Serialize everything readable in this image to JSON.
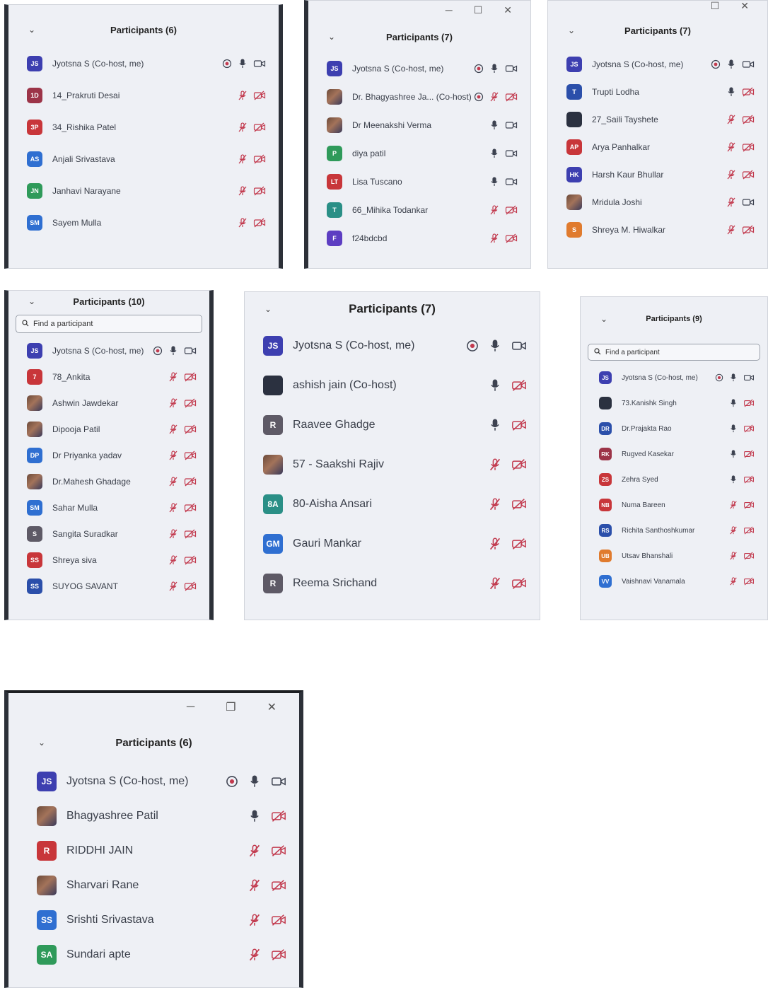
{
  "colors": {
    "purple": "#3d3fb0",
    "red": "#c8363a",
    "green": "#2f9a5a",
    "teal": "#2a8f86",
    "blue": "#2f6fd1",
    "navy": "#2b4faa",
    "maroon": "#9c3448",
    "gray": "#5e5a66",
    "orange": "#e07b2e",
    "dark": "#2b3140",
    "violet": "#5d3ec2",
    "muted_icon": "#c23a4e"
  },
  "panels": [
    {
      "title": "Participants (6)",
      "participants": [
        {
          "initials": "JS",
          "name": "Jyotsna S (Co-host, me)",
          "color": "purple",
          "record": true,
          "mic": "on",
          "video": "on"
        },
        {
          "initials": "1D",
          "name": "14_Prakruti Desai",
          "color": "maroon",
          "mic": "muted",
          "video": "off"
        },
        {
          "initials": "3P",
          "name": "34_Rishika Patel",
          "color": "red",
          "mic": "muted",
          "video": "off"
        },
        {
          "initials": "AS",
          "name": "Anjali Srivastava",
          "color": "blue",
          "mic": "muted",
          "video": "off"
        },
        {
          "initials": "JN",
          "name": "Janhavi Narayane",
          "color": "green",
          "mic": "muted",
          "video": "off"
        },
        {
          "initials": "SM",
          "name": "Sayem Mulla",
          "color": "blue",
          "mic": "muted",
          "video": "off"
        }
      ]
    },
    {
      "title": "Participants (7)",
      "participants": [
        {
          "initials": "JS",
          "name": "Jyotsna S (Co-host, me)",
          "color": "purple",
          "record": true,
          "mic": "on",
          "video": "on"
        },
        {
          "initials": "",
          "name": "Dr. Bhagyashree Ja... (Co-host)",
          "color": "photo",
          "record": true,
          "mic": "muted",
          "video": "off"
        },
        {
          "initials": "",
          "name": "Dr Meenakshi Verma",
          "color": "photo",
          "mic": "on",
          "video": "on"
        },
        {
          "initials": "P",
          "name": "diya patil",
          "color": "green",
          "mic": "on",
          "video": "on"
        },
        {
          "initials": "LT",
          "name": "Lisa Tuscano",
          "color": "red",
          "mic": "on",
          "video": "on"
        },
        {
          "initials": "T",
          "name": "66_Mihika Todankar",
          "color": "teal",
          "mic": "muted",
          "video": "off"
        },
        {
          "initials": "F",
          "name": "f24bdcbd",
          "color": "violet",
          "mic": "muted",
          "video": "off"
        }
      ]
    },
    {
      "title": "Participants (7)",
      "participants": [
        {
          "initials": "JS",
          "name": "Jyotsna S (Co-host, me)",
          "color": "purple",
          "record": true,
          "mic": "on",
          "video": "on"
        },
        {
          "initials": "T",
          "name": "Trupti Lodha",
          "color": "navy",
          "mic": "on",
          "video": "off"
        },
        {
          "initials": "",
          "name": "27_Saili Tayshete",
          "color": "dark",
          "mic": "muted",
          "video": "off"
        },
        {
          "initials": "AP",
          "name": "Arya Panhalkar",
          "color": "red",
          "mic": "muted",
          "video": "off"
        },
        {
          "initials": "HK",
          "name": "Harsh Kaur Bhullar",
          "color": "purple",
          "mic": "muted",
          "video": "off"
        },
        {
          "initials": "",
          "name": "Mridula Joshi",
          "color": "photo",
          "mic": "muted",
          "video": "on"
        },
        {
          "initials": "S",
          "name": "Shreya M. Hiwalkar",
          "color": "orange",
          "mic": "muted",
          "video": "off"
        }
      ]
    },
    {
      "title": "Participants (10)",
      "search_placeholder": "Find a participant",
      "participants": [
        {
          "initials": "JS",
          "name": "Jyotsna S (Co-host, me)",
          "color": "purple",
          "record": true,
          "mic": "on",
          "video": "on"
        },
        {
          "initials": "7",
          "name": "78_Ankita",
          "color": "red",
          "mic": "muted",
          "video": "off"
        },
        {
          "initials": "",
          "name": "Ashwin Jawdekar",
          "color": "photo",
          "mic": "muted",
          "video": "off"
        },
        {
          "initials": "",
          "name": "Dipooja Patil",
          "color": "photo",
          "mic": "muted",
          "video": "off"
        },
        {
          "initials": "DP",
          "name": "Dr Priyanka yadav",
          "color": "blue",
          "mic": "muted",
          "video": "off"
        },
        {
          "initials": "",
          "name": "Dr.Mahesh Ghadage",
          "color": "photo",
          "mic": "muted",
          "video": "off"
        },
        {
          "initials": "SM",
          "name": "Sahar Mulla",
          "color": "blue",
          "mic": "muted",
          "video": "off"
        },
        {
          "initials": "S",
          "name": "Sangita Suradkar",
          "color": "gray",
          "mic": "muted",
          "video": "off"
        },
        {
          "initials": "SS",
          "name": "Shreya siva",
          "color": "red",
          "mic": "muted",
          "video": "off"
        },
        {
          "initials": "SS",
          "name": "SUYOG SAVANT",
          "color": "navy",
          "mic": "muted",
          "video": "off"
        }
      ]
    },
    {
      "title": "Participants (7)",
      "participants": [
        {
          "initials": "JS",
          "name": "Jyotsna S (Co-host, me)",
          "color": "purple",
          "record": true,
          "mic": "on",
          "video": "on"
        },
        {
          "initials": "",
          "name": "ashish jain (Co-host)",
          "color": "dark",
          "mic": "on",
          "video": "off"
        },
        {
          "initials": "R",
          "name": "Raavee Ghadge",
          "color": "gray",
          "mic": "on",
          "video": "off"
        },
        {
          "initials": "",
          "name": "57 - Saakshi Rajiv",
          "color": "photo",
          "mic": "muted",
          "video": "off"
        },
        {
          "initials": "8A",
          "name": "80-Aisha Ansari",
          "color": "teal",
          "mic": "muted",
          "video": "off"
        },
        {
          "initials": "GM",
          "name": "Gauri Mankar",
          "color": "blue",
          "mic": "muted",
          "video": "off"
        },
        {
          "initials": "R",
          "name": "Reema Srichand",
          "color": "gray",
          "mic": "muted",
          "video": "off"
        }
      ]
    },
    {
      "title": "Participants (9)",
      "search_placeholder": "Find a participant",
      "participants": [
        {
          "initials": "JS",
          "name": "Jyotsna S (Co-host, me)",
          "color": "purple",
          "record": true,
          "mic": "on",
          "video": "on"
        },
        {
          "initials": "",
          "name": "73.Kanishk Singh",
          "color": "dark",
          "mic": "on",
          "video": "off"
        },
        {
          "initials": "DR",
          "name": "Dr.Prajakta Rao",
          "color": "navy",
          "mic": "on",
          "video": "off"
        },
        {
          "initials": "RK",
          "name": "Rugved Kasekar",
          "color": "maroon",
          "mic": "on",
          "video": "off"
        },
        {
          "initials": "ZS",
          "name": "Zehra Syed",
          "color": "red",
          "mic": "on",
          "video": "off"
        },
        {
          "initials": "NB",
          "name": "Numa Bareen",
          "color": "red",
          "mic": "muted",
          "video": "off"
        },
        {
          "initials": "RS",
          "name": "Richita Santhoshkumar",
          "color": "navy",
          "mic": "muted",
          "video": "off"
        },
        {
          "initials": "UB",
          "name": "Utsav Bhanshali",
          "color": "orange",
          "mic": "muted",
          "video": "off"
        },
        {
          "initials": "VV",
          "name": "Vaishnavi Vanamala",
          "color": "blue",
          "mic": "muted",
          "video": "off"
        }
      ]
    },
    {
      "title": "Participants (6)",
      "participants": [
        {
          "initials": "JS",
          "name": "Jyotsna S (Co-host, me)",
          "color": "purple",
          "record": true,
          "mic": "on",
          "video": "on"
        },
        {
          "initials": "",
          "name": "Bhagyashree Patil",
          "color": "photo",
          "mic": "on",
          "video": "off"
        },
        {
          "initials": "R",
          "name": "RIDDHI JAIN",
          "color": "red",
          "mic": "muted",
          "video": "off"
        },
        {
          "initials": "",
          "name": "Sharvari Rane",
          "color": "photo",
          "mic": "muted",
          "video": "off"
        },
        {
          "initials": "SS",
          "name": "Srishti Srivastava",
          "color": "blue",
          "mic": "muted",
          "video": "off"
        },
        {
          "initials": "SA",
          "name": "Sundari apte",
          "color": "green",
          "mic": "muted",
          "video": "off"
        }
      ]
    }
  ]
}
